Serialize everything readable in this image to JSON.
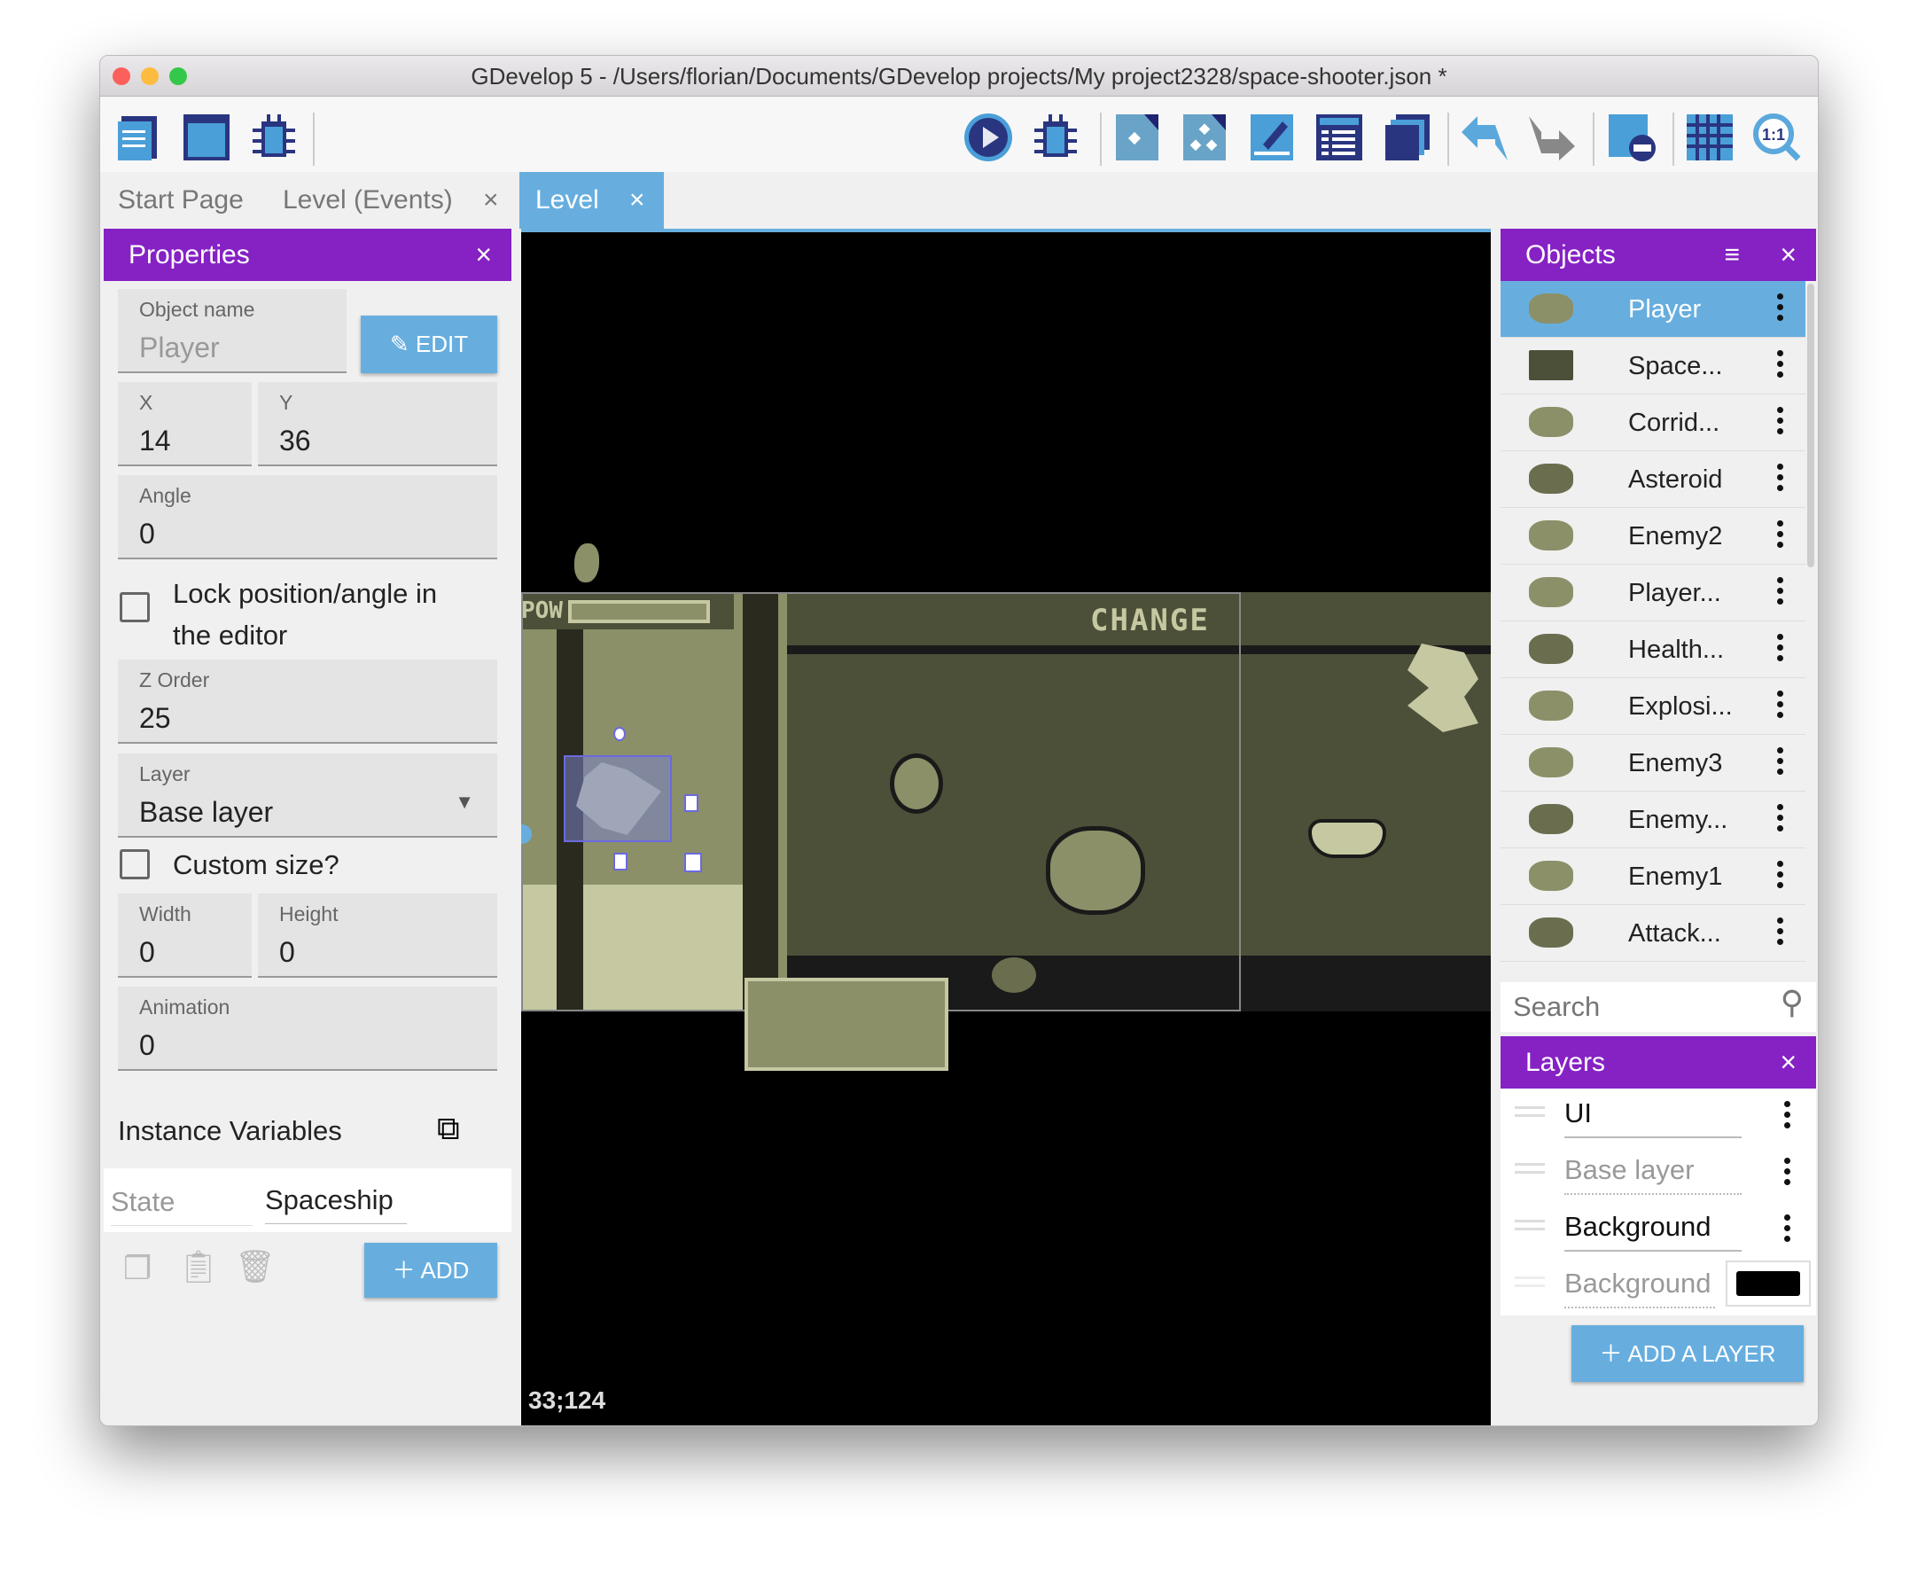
{
  "window": {
    "title": "GDevelop 5 - /Users/florian/Documents/GDevelop projects/My project2328/space-shooter.json *"
  },
  "toolbar": {
    "left_icons": [
      "project-manager-icon",
      "scene-icon",
      "debugger-icon"
    ],
    "right_icons": [
      "preview-play-icon",
      "debug-icon",
      "add-instance-icon",
      "add-instances-icon",
      "edit-object-icon",
      "object-list-icon",
      "layers-icon",
      "undo-icon",
      "redo-icon",
      "delete-icon",
      "grid-icon",
      "zoom-reset-icon"
    ]
  },
  "tabs": [
    {
      "label": "Start Page"
    },
    {
      "label": "Level (Events)",
      "close": "×"
    },
    {
      "label": "Level",
      "close": "×",
      "active": true
    }
  ],
  "properties": {
    "title": "Properties",
    "close": "×",
    "object_name_label": "Object name",
    "object_name": "Player",
    "edit": "EDIT",
    "x_label": "X",
    "x": "14",
    "y_label": "Y",
    "y": "36",
    "angle_label": "Angle",
    "angle": "0",
    "lock_label": "Lock position/angle in the editor",
    "lock_checked": false,
    "z_label": "Z Order",
    "z": "25",
    "layer_label": "Layer",
    "layer": "Base layer",
    "custom_size_label": "Custom size?",
    "custom_size_checked": false,
    "width_label": "Width",
    "width": "0",
    "height_label": "Height",
    "height": "0",
    "animation_label": "Animation",
    "animation": "0",
    "instance_vars": "Instance Variables",
    "var_name": "State",
    "var_value": "Spaceship",
    "add": "ADD"
  },
  "canvas": {
    "coords": "33;124",
    "hud_text": "CHANGE",
    "pow_text": "POW"
  },
  "objects": {
    "title": "Objects",
    "close": "×",
    "items": [
      {
        "name": "Player",
        "selected": true
      },
      {
        "name": "Space..."
      },
      {
        "name": "Corrid..."
      },
      {
        "name": "Asteroid"
      },
      {
        "name": "Enemy2"
      },
      {
        "name": "Player..."
      },
      {
        "name": "Health..."
      },
      {
        "name": "Explosi..."
      },
      {
        "name": "Enemy3"
      },
      {
        "name": "Enemy..."
      },
      {
        "name": "Enemy1"
      },
      {
        "name": "Attack..."
      }
    ],
    "search_placeholder": "Search"
  },
  "layers": {
    "title": "Layers",
    "close": "×",
    "items": [
      {
        "name": "UI"
      },
      {
        "name": "Base layer",
        "dim": true
      },
      {
        "name": "Background"
      }
    ],
    "bg_label": "Background color",
    "bg_color": "#000000",
    "add": "ADD A LAYER"
  },
  "colors": {
    "accent_purple": "#8621c4",
    "accent_blue": "#67aedf"
  }
}
